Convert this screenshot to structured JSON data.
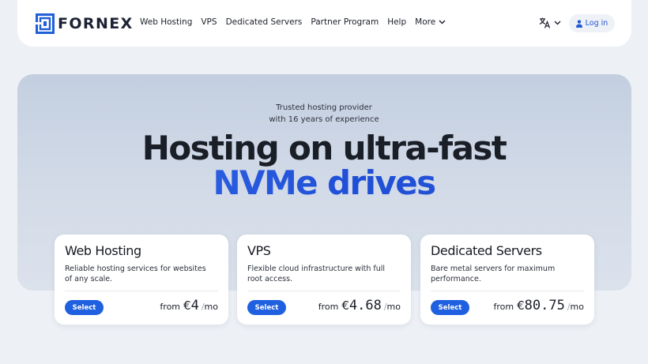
{
  "brand": {
    "name": "FORNEX",
    "color": "#1f5fd8",
    "icon": "fornex-logo-icon"
  },
  "nav": {
    "items": [
      "Web Hosting",
      "VPS",
      "Dedicated Servers",
      "Partner Program",
      "Help"
    ],
    "more_label": "More",
    "more_icon": "chevron-down-icon",
    "language_icon": "translate-icon",
    "login_label": "Log in",
    "login_icon": "user-icon"
  },
  "hero": {
    "tagline_line1": "Trusted hosting provider",
    "tagline_line2": "with 16 years of experience",
    "headline": "Hosting on ultra-fast",
    "headline_accent": "NVMe drives",
    "accent_color": "#2a5fe4"
  },
  "plans": [
    {
      "title": "Web Hosting",
      "description": "Reliable hosting services for websites of any scale.",
      "button": "Select",
      "price_prefix": "from",
      "currency": "€",
      "amount": "4",
      "period": "mo"
    },
    {
      "title": "VPS",
      "description": "Flexible cloud infrastructure with full root access.",
      "button": "Select",
      "price_prefix": "from",
      "currency": "€",
      "amount": "4.68",
      "period": "mo"
    },
    {
      "title": "Dedicated Servers",
      "description": "Bare metal servers for maximum performance.",
      "button": "Select",
      "price_prefix": "from",
      "currency": "€",
      "amount": "80.75",
      "period": "mo"
    }
  ],
  "colors": {
    "button": "#1f60e0",
    "background": "#edf0f5",
    "hero": "#c9d4e4"
  }
}
